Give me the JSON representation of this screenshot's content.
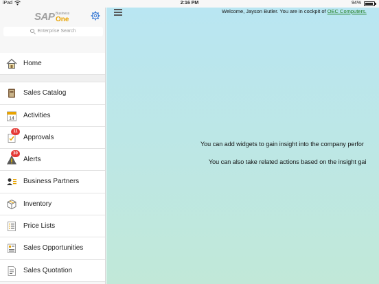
{
  "status_bar": {
    "carrier": "iPad",
    "time": "2:16 PM",
    "battery": "94%"
  },
  "sidebar": {
    "brand": {
      "sap": "SAP",
      "business": "Business",
      "one": "One"
    },
    "search_placeholder": "Enterprise Search",
    "items": [
      {
        "label": "Home",
        "icon": "home-icon"
      },
      {
        "label": "Sales Catalog",
        "icon": "catalog-icon"
      },
      {
        "label": "Activities",
        "icon": "calendar-icon",
        "icon_text": "14"
      },
      {
        "label": "Approvals",
        "icon": "approval-icon",
        "badge": "11"
      },
      {
        "label": "Alerts",
        "icon": "alert-icon",
        "badge": "30"
      },
      {
        "label": "Business Partners",
        "icon": "partners-icon"
      },
      {
        "label": "Inventory",
        "icon": "box-icon"
      },
      {
        "label": "Price Lists",
        "icon": "list-icon"
      },
      {
        "label": "Sales Opportunities",
        "icon": "opportunity-icon"
      },
      {
        "label": "Sales Quotation",
        "icon": "quotation-icon"
      }
    ]
  },
  "main": {
    "welcome_prefix": "Welcome, Jayson Butler. You are in cockpit of ",
    "company_link": "OEC Computers.",
    "hint_1": "You can add widgets to gain insight into the company perfor",
    "hint_2": "You can also take related actions based on the insight gai"
  },
  "colors": {
    "accent_green": "#1a7a1a",
    "badge_red": "#e53935",
    "brand_orange": "#e8a300",
    "main_bg_top": "#b9e6f2",
    "main_bg_bottom": "#c1e8d8"
  }
}
